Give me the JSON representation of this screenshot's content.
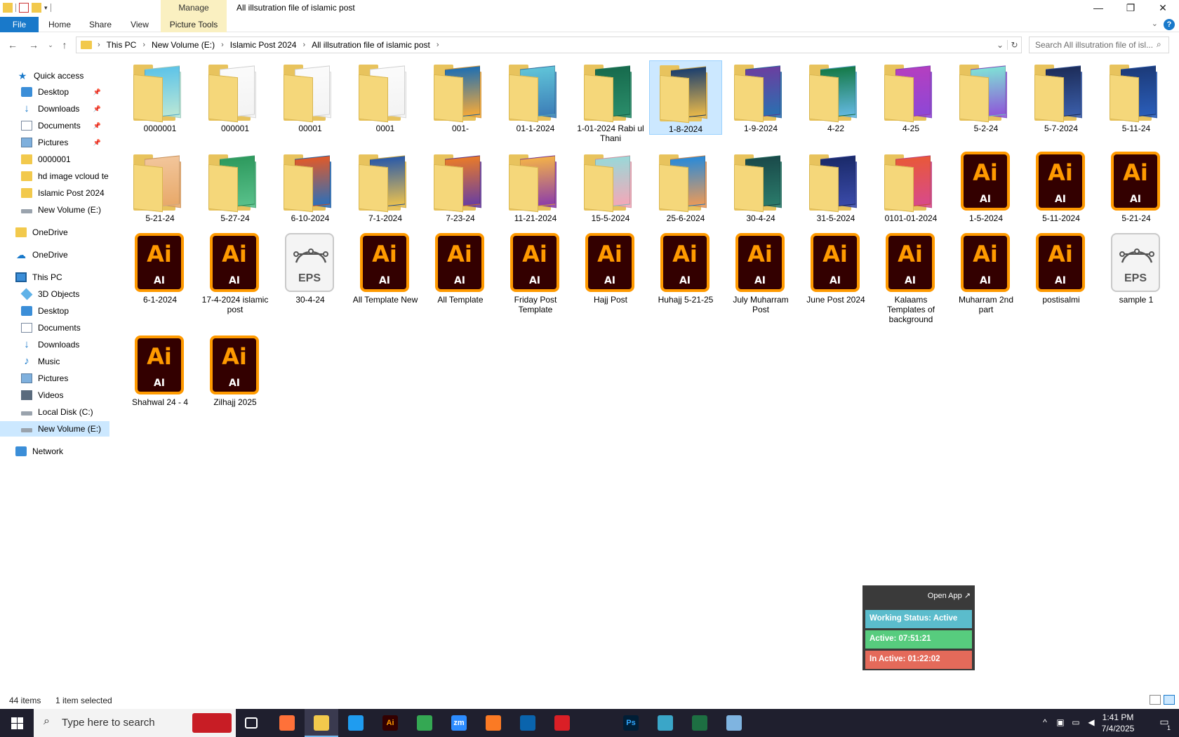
{
  "window": {
    "title": "All illsutration file of islamic post",
    "manage_tab": "Manage",
    "minimize": "—",
    "restore": "❐",
    "close": "✕"
  },
  "ribbon": {
    "tabs": [
      "File",
      "Home",
      "Share",
      "View",
      "Picture Tools"
    ],
    "help": "?"
  },
  "address": {
    "crumbs": [
      "This PC",
      "New Volume (E:)",
      "Islamic Post 2024",
      "All illsutration file of islamic post"
    ],
    "search_placeholder": "Search All illsutration file of isl..."
  },
  "navpane": {
    "items": [
      {
        "label": "Quick access",
        "icon": "star-icon",
        "pinned": false
      },
      {
        "label": "Desktop",
        "icon": "desktop-icon",
        "pinned": true
      },
      {
        "label": "Downloads",
        "icon": "download-icon",
        "pinned": true
      },
      {
        "label": "Documents",
        "icon": "documents-icon",
        "pinned": true
      },
      {
        "label": "Pictures",
        "icon": "pictures-icon",
        "pinned": true
      },
      {
        "label": "0000001",
        "icon": "folder-icon",
        "pinned": false
      },
      {
        "label": "hd image vcloud te",
        "icon": "folder-icon",
        "pinned": false
      },
      {
        "label": "Islamic Post 2024",
        "icon": "folder-icon",
        "pinned": false
      },
      {
        "label": "New Volume (E:)",
        "icon": "drive-icon",
        "pinned": false
      },
      {
        "label": "OneDrive",
        "icon": "folder-icon",
        "pinned": false
      },
      {
        "label": "OneDrive",
        "icon": "cloud-icon",
        "pinned": false
      },
      {
        "label": "This PC",
        "icon": "pc-icon",
        "pinned": false
      },
      {
        "label": "3D Objects",
        "icon": "3d-objects-icon",
        "pinned": false
      },
      {
        "label": "Desktop",
        "icon": "desktop-icon",
        "pinned": false
      },
      {
        "label": "Documents",
        "icon": "documents-icon",
        "pinned": false
      },
      {
        "label": "Downloads",
        "icon": "download-icon",
        "pinned": false
      },
      {
        "label": "Music",
        "icon": "music-icon",
        "pinned": false
      },
      {
        "label": "Pictures",
        "icon": "pictures-icon",
        "pinned": false
      },
      {
        "label": "Videos",
        "icon": "videos-icon",
        "pinned": false
      },
      {
        "label": "Local Disk (C:)",
        "icon": "drive-icon",
        "pinned": false
      },
      {
        "label": "New Volume (E:)",
        "icon": "drive-icon",
        "pinned": false,
        "selected": true
      },
      {
        "label": "Network",
        "icon": "network-icon",
        "pinned": false
      }
    ]
  },
  "files": [
    {
      "name": "0000001",
      "type": "folder",
      "colors": [
        "#5ec4e8",
        "#b8e6d6"
      ]
    },
    {
      "name": "000001",
      "type": "folder-empty"
    },
    {
      "name": "00001",
      "type": "folder-empty"
    },
    {
      "name": "0001",
      "type": "folder-empty"
    },
    {
      "name": "001-",
      "type": "folder",
      "colors": [
        "#1f6fb2",
        "#f2a93b"
      ]
    },
    {
      "name": "01-1-2024",
      "type": "folder",
      "colors": [
        "#5fc3d8",
        "#3d7fb8"
      ]
    },
    {
      "name": "1-01-2024 Rabi ul Thani",
      "type": "folder",
      "colors": [
        "#176b4d",
        "#2a8c6a"
      ]
    },
    {
      "name": "1-8-2024",
      "type": "folder",
      "colors": [
        "#1c3f6e",
        "#e8b84a"
      ],
      "selected": true
    },
    {
      "name": "1-9-2024",
      "type": "folder",
      "colors": [
        "#6a3fa0",
        "#2b6fb0"
      ]
    },
    {
      "name": "4-22",
      "type": "folder",
      "colors": [
        "#157a48",
        "#62b7de"
      ]
    },
    {
      "name": "4-25",
      "type": "folder",
      "colors": [
        "#b43fc0",
        "#8e47d6"
      ]
    },
    {
      "name": "5-2-24",
      "type": "folder",
      "colors": [
        "#7fe0d6",
        "#8e58d8"
      ]
    },
    {
      "name": "5-7-2024",
      "type": "folder",
      "colors": [
        "#1d2d5a",
        "#3a5da8"
      ]
    },
    {
      "name": "5-11-24",
      "type": "folder",
      "colors": [
        "#1c3b7a",
        "#2a5db8"
      ]
    },
    {
      "name": "5-21-24",
      "type": "folder",
      "colors": [
        "#f2c59a",
        "#e8a96a"
      ]
    },
    {
      "name": "5-27-24",
      "type": "folder",
      "colors": [
        "#2e9a5e",
        "#58c08a"
      ]
    },
    {
      "name": "6-10-2024",
      "type": "folder",
      "colors": [
        "#e05a2a",
        "#2e6fb8"
      ]
    },
    {
      "name": "7-1-2024",
      "type": "folder",
      "colors": [
        "#2a5aa8",
        "#e8c050"
      ]
    },
    {
      "name": "7-23-24",
      "type": "folder",
      "colors": [
        "#e87a2a",
        "#6a3fa0"
      ]
    },
    {
      "name": "11-21-2024",
      "type": "folder",
      "colors": [
        "#f2b04a",
        "#8e3fa8"
      ]
    },
    {
      "name": "15-5-2024",
      "type": "folder",
      "colors": [
        "#9ad8d8",
        "#f2a8b8"
      ]
    },
    {
      "name": "25-6-2024",
      "type": "folder",
      "colors": [
        "#2a8ad8",
        "#e89a5a"
      ]
    },
    {
      "name": "30-4-24",
      "type": "folder",
      "colors": [
        "#1a4a4a",
        "#2a7a6a"
      ]
    },
    {
      "name": "31-5-2024",
      "type": "folder",
      "colors": [
        "#1a2a6a",
        "#3a4aa8"
      ]
    },
    {
      "name": "0101-01-2024",
      "type": "folder",
      "colors": [
        "#e8583a",
        "#d84a8a"
      ]
    },
    {
      "name": "1-5-2024",
      "type": "ai"
    },
    {
      "name": "5-11-2024",
      "type": "ai"
    },
    {
      "name": "5-21-24",
      "type": "ai"
    },
    {
      "name": "6-1-2024",
      "type": "ai"
    },
    {
      "name": "17-4-2024 islamic post",
      "type": "ai"
    },
    {
      "name": "30-4-24",
      "type": "eps"
    },
    {
      "name": "All Template New",
      "type": "ai"
    },
    {
      "name": "All Template",
      "type": "ai"
    },
    {
      "name": "Friday Post Template",
      "type": "ai"
    },
    {
      "name": "Hajj Post",
      "type": "ai"
    },
    {
      "name": "Huhajj 5-21-25",
      "type": "ai"
    },
    {
      "name": "July Muharram Post",
      "type": "ai"
    },
    {
      "name": "June Post 2024",
      "type": "ai"
    },
    {
      "name": "Kalaams Templates of background",
      "type": "ai"
    },
    {
      "name": "Muharram 2nd part",
      "type": "ai"
    },
    {
      "name": "postisalmi",
      "type": "ai"
    },
    {
      "name": "sample 1",
      "type": "eps"
    },
    {
      "name": "Shahwal 24 - 4",
      "type": "ai"
    },
    {
      "name": "Zilhajj 2025",
      "type": "ai"
    }
  ],
  "file_icon_text": {
    "ai_big": "Ai",
    "ai_small": "AI",
    "eps": "EPS"
  },
  "widget": {
    "open_app": "Open App ↗",
    "status": "Working Status: Active",
    "active": "Active: 07:51:21",
    "inactive": "In Active: 01:22:02",
    "colors": {
      "status": "#5bbccc",
      "active": "#57cc7e",
      "inactive": "#e46a5a"
    }
  },
  "statusbar": {
    "count": "44 items",
    "selection": "1 item selected"
  },
  "taskbar": {
    "search_placeholder": "Type here to search",
    "apps": [
      {
        "name": "task-view-icon",
        "label": "",
        "color": "#1f1f2e",
        "active": false
      },
      {
        "name": "firefox-icon",
        "label": "",
        "color": "#ff7139",
        "active": false
      },
      {
        "name": "file-explorer-icon",
        "label": "",
        "color": "#f2c94c",
        "active": true
      },
      {
        "name": "vscode-icon",
        "label": "",
        "color": "#1f9cf0",
        "active": false
      },
      {
        "name": "illustrator-icon",
        "label": "Ai",
        "color": "#330000",
        "active": false
      },
      {
        "name": "chrome-icon",
        "label": "",
        "color": "#34a853",
        "active": false
      },
      {
        "name": "zoom-icon",
        "label": "zm",
        "color": "#2d8cff",
        "active": false
      },
      {
        "name": "xampp-icon",
        "label": "",
        "color": "#fb7a24",
        "active": false
      },
      {
        "name": "outlook-icon",
        "label": "",
        "color": "#0a64ad",
        "active": false
      },
      {
        "name": "creative-cloud-icon",
        "label": "",
        "color": "#da1f26",
        "active": false
      },
      {
        "name": "pen-tool-icon",
        "label": "",
        "color": "#1f1f2e",
        "active": false
      },
      {
        "name": "photoshop-icon",
        "label": "Ps",
        "color": "#001e36",
        "active": false
      },
      {
        "name": "app-diamond-icon",
        "label": "",
        "color": "#3aa6c8",
        "active": false
      },
      {
        "name": "excel-icon",
        "label": "",
        "color": "#1d6f42",
        "active": false
      },
      {
        "name": "notepad-icon",
        "label": "",
        "color": "#7fb4e0",
        "active": false
      }
    ],
    "time": "1:41 PM",
    "date": "7/4/2025",
    "notifications": "1"
  }
}
